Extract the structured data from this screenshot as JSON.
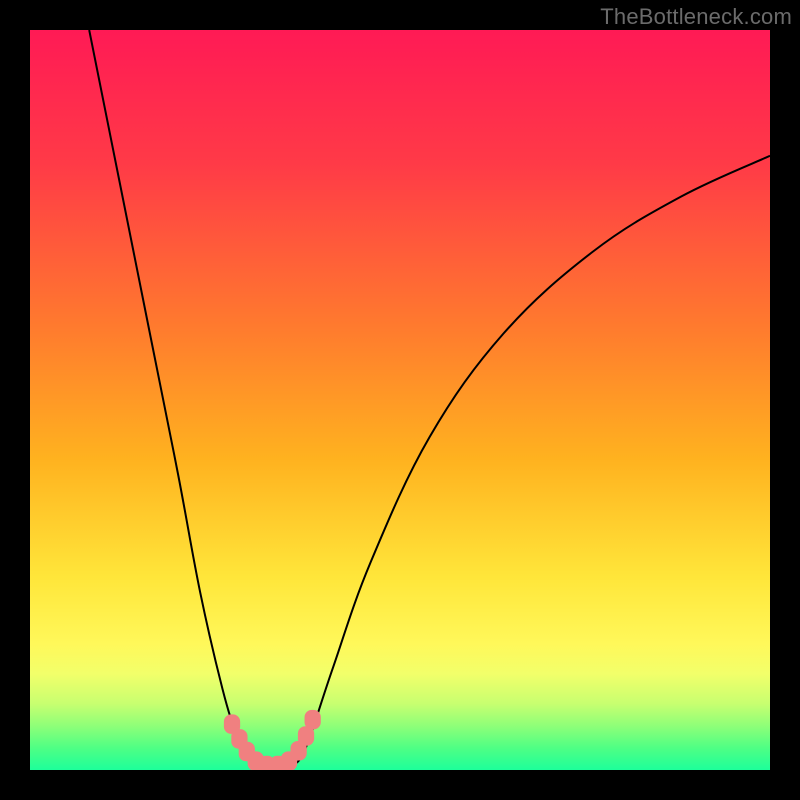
{
  "watermark": "TheBottleneck.com",
  "chart_data": {
    "type": "line",
    "title": "",
    "xlabel": "",
    "ylabel": "",
    "xlim": [
      0,
      100
    ],
    "ylim": [
      0,
      100
    ],
    "gradient_stops": [
      {
        "offset": 0,
        "color": "#ff1a55"
      },
      {
        "offset": 18,
        "color": "#ff3a47"
      },
      {
        "offset": 40,
        "color": "#ff7a2e"
      },
      {
        "offset": 58,
        "color": "#ffb21f"
      },
      {
        "offset": 74,
        "color": "#ffe63a"
      },
      {
        "offset": 83,
        "color": "#fff85a"
      },
      {
        "offset": 87,
        "color": "#f2ff6a"
      },
      {
        "offset": 91,
        "color": "#c8ff70"
      },
      {
        "offset": 94,
        "color": "#8fff78"
      },
      {
        "offset": 97,
        "color": "#4fff84"
      },
      {
        "offset": 100,
        "color": "#1dff9a"
      }
    ],
    "series": [
      {
        "name": "left-arm",
        "type": "curve",
        "points": [
          {
            "x": 8.0,
            "y": 100.0
          },
          {
            "x": 12.0,
            "y": 80.0
          },
          {
            "x": 16.0,
            "y": 60.0
          },
          {
            "x": 20.0,
            "y": 40.0
          },
          {
            "x": 23.0,
            "y": 24.0
          },
          {
            "x": 26.0,
            "y": 11.0
          },
          {
            "x": 28.0,
            "y": 4.5
          },
          {
            "x": 29.5,
            "y": 1.5
          }
        ]
      },
      {
        "name": "trough",
        "type": "curve",
        "points": [
          {
            "x": 29.5,
            "y": 1.5
          },
          {
            "x": 31.0,
            "y": 0.6
          },
          {
            "x": 33.0,
            "y": 0.3
          },
          {
            "x": 35.0,
            "y": 0.6
          },
          {
            "x": 36.5,
            "y": 1.5
          }
        ]
      },
      {
        "name": "right-arm",
        "type": "curve",
        "points": [
          {
            "x": 36.5,
            "y": 1.5
          },
          {
            "x": 38.0,
            "y": 5.0
          },
          {
            "x": 41.0,
            "y": 14.0
          },
          {
            "x": 46.0,
            "y": 28.0
          },
          {
            "x": 54.0,
            "y": 45.0
          },
          {
            "x": 64.0,
            "y": 59.0
          },
          {
            "x": 76.0,
            "y": 70.0
          },
          {
            "x": 88.0,
            "y": 77.5
          },
          {
            "x": 100.0,
            "y": 83.0
          }
        ]
      }
    ],
    "markers": [
      {
        "x": 27.3,
        "y": 6.2,
        "r": 2.0
      },
      {
        "x": 28.3,
        "y": 4.2,
        "r": 2.0
      },
      {
        "x": 29.3,
        "y": 2.5,
        "r": 2.0
      },
      {
        "x": 30.5,
        "y": 1.2,
        "r": 2.0
      },
      {
        "x": 32.0,
        "y": 0.6,
        "r": 2.0
      },
      {
        "x": 33.5,
        "y": 0.6,
        "r": 2.0
      },
      {
        "x": 35.0,
        "y": 1.2,
        "r": 2.0
      },
      {
        "x": 36.3,
        "y": 2.6,
        "r": 2.0
      },
      {
        "x": 37.3,
        "y": 4.6,
        "r": 2.0
      },
      {
        "x": 38.2,
        "y": 6.8,
        "r": 2.0
      }
    ],
    "colors": {
      "curve": "#000000",
      "marker_fill": "#f08080",
      "marker_stroke": "#c05050"
    }
  }
}
